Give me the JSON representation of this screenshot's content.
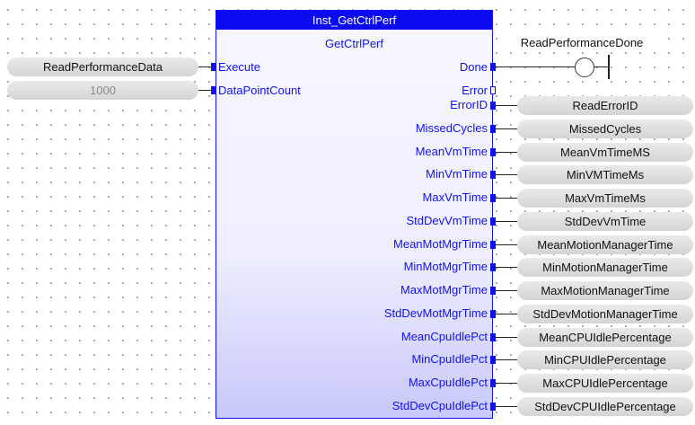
{
  "block": {
    "instance": "Inst_GetCtrlPerf",
    "type": "GetCtrlPerf",
    "color": "#0a0aee"
  },
  "inputs": [
    {
      "pin": "Execute",
      "variable": "ReadPerformanceData",
      "constant": false
    },
    {
      "pin": "DataPointCount",
      "variable": "1000",
      "constant": true
    }
  ],
  "done_output": {
    "pin": "Done",
    "variable": "ReadPerformanceDone"
  },
  "error_output": {
    "pin": "Error"
  },
  "outputs": [
    {
      "pin": "ErrorID",
      "variable": "ReadErrorID"
    },
    {
      "pin": "MissedCycles",
      "variable": "MissedCycles"
    },
    {
      "pin": "MeanVmTime",
      "variable": "MeanVmTimeMS"
    },
    {
      "pin": "MinVmTime",
      "variable": "MinVMTimeMs"
    },
    {
      "pin": "MaxVmTime",
      "variable": "MaxVmTimeMs"
    },
    {
      "pin": "StdDevVmTime",
      "variable": "StdDevVmTime"
    },
    {
      "pin": "MeanMotMgrTime",
      "variable": "MeanMotionManagerTime"
    },
    {
      "pin": "MinMotMgrTime",
      "variable": "MinMotionManagerTime"
    },
    {
      "pin": "MaxMotMgrTime",
      "variable": "MaxMotionManagerTime"
    },
    {
      "pin": "StdDevMotMgrTime",
      "variable": "StdDevMotionManagerTime"
    },
    {
      "pin": "MeanCpuIdlePct",
      "variable": "MeanCPUIdlePercentage"
    },
    {
      "pin": "MinCpuIdlePct",
      "variable": "MinCPUIdlePercentage"
    },
    {
      "pin": "MaxCpuIdlePct",
      "variable": "MaxCPUIdlePercentage"
    },
    {
      "pin": "StdDevCpuIdlePct",
      "variable": "StdDevCPUIdlePercentage"
    }
  ]
}
